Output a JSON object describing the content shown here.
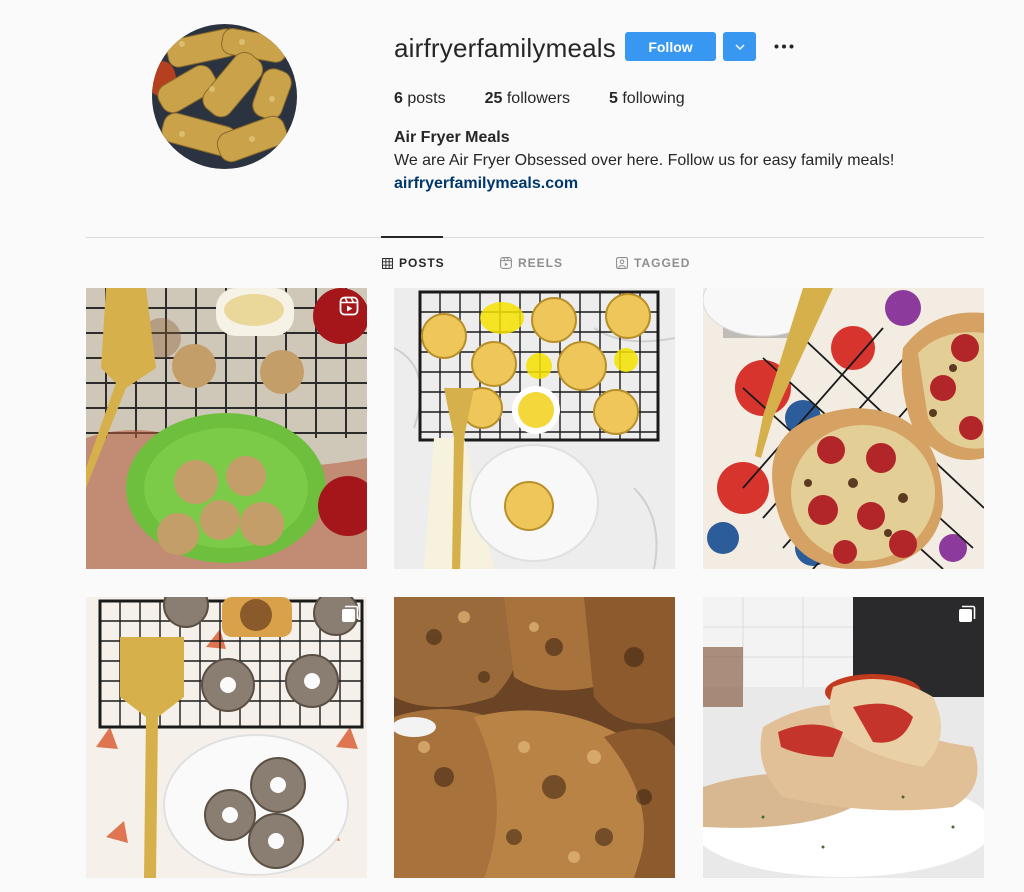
{
  "profile": {
    "username": "airfryerfamilymeals",
    "follow_label": "Follow",
    "stats": {
      "posts_count": "6",
      "posts_label": "posts",
      "followers_count": "25",
      "followers_label": "followers",
      "following_count": "5",
      "following_label": "following"
    },
    "full_name": "Air Fryer Meals",
    "bio": "We are Air Fryer Obsessed over here. Follow us for easy family meals!",
    "website": "airfryerfamilymeals.com"
  },
  "tabs": [
    {
      "label": "POSTS",
      "icon": "grid-icon",
      "active": true
    },
    {
      "label": "REELS",
      "icon": "reels-icon",
      "active": false
    },
    {
      "label": "TAGGED",
      "icon": "tagged-icon",
      "active": false
    }
  ],
  "posts": [
    {
      "name": "apple-dumplings",
      "badge": "reel-icon"
    },
    {
      "name": "lemon-tarts",
      "badge": ""
    },
    {
      "name": "pepperoni-pizzas",
      "badge": ""
    },
    {
      "name": "cinnamon-donuts",
      "badge": "carousel-icon"
    },
    {
      "name": "fried-chicken",
      "badge": ""
    },
    {
      "name": "pizza-pockets",
      "badge": "carousel-icon"
    }
  ],
  "colors": {
    "accent": "#3897f0",
    "link": "#00376b",
    "text": "#262626",
    "muted": "#8e8e8e",
    "background": "#fafafa"
  }
}
